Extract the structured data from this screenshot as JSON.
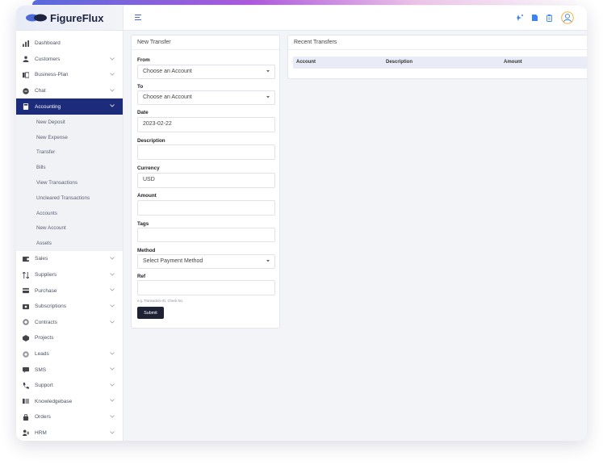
{
  "app": {
    "name": "FigureFlux"
  },
  "sidebar": {
    "items": [
      {
        "label": "Dashboard",
        "icon": "dashboard-icon",
        "chevron": false
      },
      {
        "label": "Customers",
        "icon": "user-icon",
        "chevron": true
      },
      {
        "label": "Business-Plan",
        "icon": "plan-icon",
        "chevron": true
      },
      {
        "label": "Chat",
        "icon": "chat-icon",
        "chevron": true
      },
      {
        "label": "Accounting",
        "icon": "calculator-icon",
        "chevron": true,
        "active": true
      }
    ],
    "accounting_sub": [
      "New Deposit",
      "New Expense",
      "Transfer",
      "Bills",
      "View Transactions",
      "Uncleared Transactions",
      "Accounts",
      "New Account",
      "Assets"
    ],
    "items_after": [
      {
        "label": "Sales",
        "icon": "sales-icon",
        "chevron": true
      },
      {
        "label": "Suppliers",
        "icon": "suppliers-icon",
        "chevron": true
      },
      {
        "label": "Purchase",
        "icon": "purchase-icon",
        "chevron": true
      },
      {
        "label": "Subscriptions",
        "icon": "subscription-icon",
        "chevron": true
      },
      {
        "label": "Contracts",
        "icon": "contract-icon",
        "chevron": true
      },
      {
        "label": "Projects",
        "icon": "projects-icon",
        "chevron": false
      },
      {
        "label": "Leads",
        "icon": "leads-icon",
        "chevron": true
      },
      {
        "label": "SMS",
        "icon": "sms-icon",
        "chevron": true
      },
      {
        "label": "Support",
        "icon": "phone-icon",
        "chevron": true
      },
      {
        "label": "Knowledgebase",
        "icon": "book-icon",
        "chevron": true
      },
      {
        "label": "Orders",
        "icon": "bag-icon",
        "chevron": true
      },
      {
        "label": "HRM",
        "icon": "hrm-icon",
        "chevron": true
      }
    ]
  },
  "topbar": {
    "icons": [
      "sparkle-icon",
      "file-icon",
      "clipboard-icon",
      "user-avatar-icon"
    ]
  },
  "form": {
    "title": "New Transfer",
    "from_label": "From",
    "from_value": "Choose an Account",
    "to_label": "To",
    "to_value": "Choose an Account",
    "date_label": "Date",
    "date_value": "2023-02-22",
    "description_label": "Description",
    "description_value": "",
    "currency_label": "Currency",
    "currency_value": "USD",
    "amount_label": "Amount",
    "amount_value": "",
    "tags_label": "Tags",
    "tags_value": "",
    "method_label": "Method",
    "method_value": "Select Payment Method",
    "ref_label": "Ref",
    "ref_value": "",
    "ref_hint": "e.g. Transaction ID, Check No.",
    "submit_label": "Submit"
  },
  "recent": {
    "title": "Recent Transfers",
    "columns": [
      "Account",
      "Description",
      "Amount"
    ]
  },
  "colors": {
    "accent": "#1c2b7a",
    "button": "#1e2234",
    "table_header": "#e9ecf7"
  }
}
